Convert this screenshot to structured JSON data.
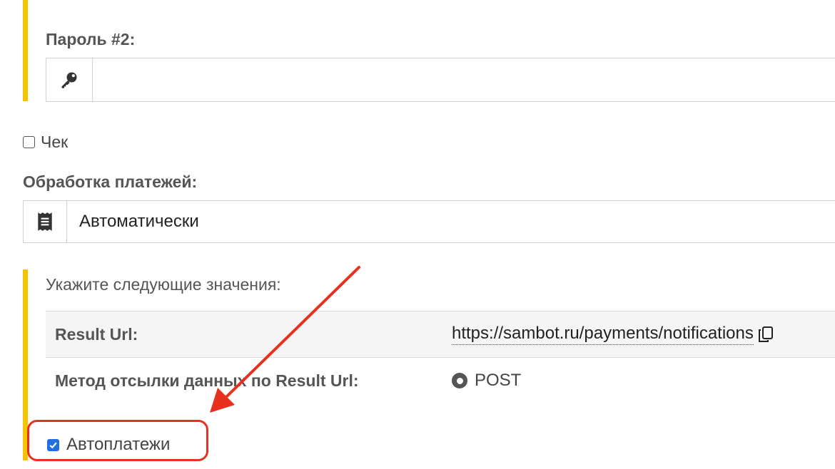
{
  "password2": {
    "label": "Пароль #2:",
    "value": "",
    "icon": "key-icon"
  },
  "receipt": {
    "label": "Чек",
    "checked": false
  },
  "payment_processing": {
    "label": "Обработка платежей:",
    "value": "Автоматически",
    "icon": "receipt-icon"
  },
  "settings": {
    "hint": "Укажите следующие значения:",
    "rows": [
      {
        "key": "Result Url:",
        "value": "https://sambot.ru/payments/notifications",
        "icon": "copy-icon"
      },
      {
        "key": "Метод отсылки данных по Result Url:",
        "value": "POST",
        "icon": "radio-selected-icon"
      }
    ]
  },
  "autopayments": {
    "label": "Автоплатежи",
    "checked": true
  },
  "colors": {
    "accent": "#f5c400",
    "annotation": "#e8301f",
    "checkbox": "#1f6fe0"
  }
}
